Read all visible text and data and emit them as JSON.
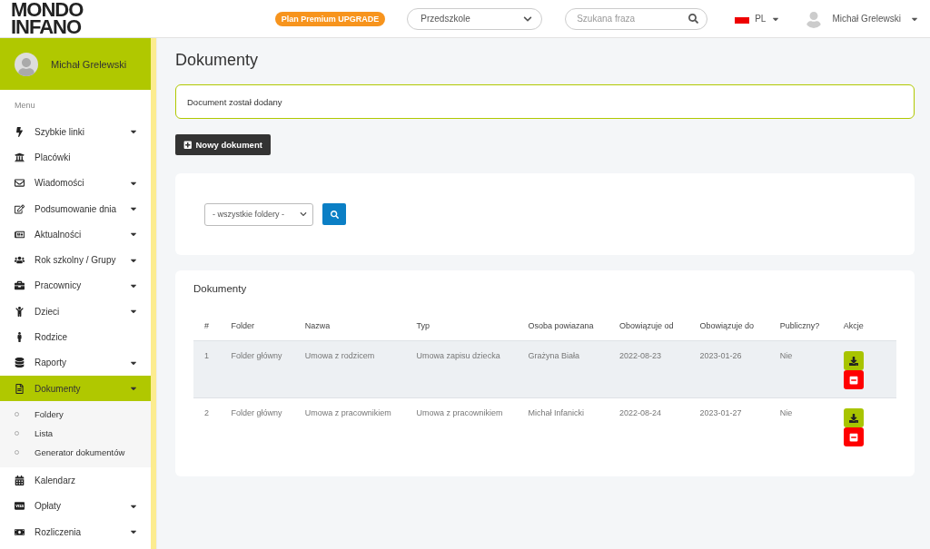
{
  "header": {
    "logo_top": "MONDO",
    "logo_bottom": "INFANO",
    "premium_badge": "Plan Premium UPGRADE",
    "facility_select": "Przedszkole",
    "search": {
      "placeholder": "Szukana fraza"
    },
    "language": "PL",
    "user": "Michał Grelewski"
  },
  "sidebar": {
    "user": "Michał Grelewski",
    "menu_label": "Menu",
    "items": [
      {
        "label": "Szybkie linki",
        "has_submenu": true,
        "selected": false
      },
      {
        "label": "Placówki",
        "has_submenu": false,
        "selected": false
      },
      {
        "label": "Wiadomości",
        "has_submenu": true,
        "selected": false
      },
      {
        "label": "Podsumowanie dnia",
        "has_submenu": true,
        "selected": false
      },
      {
        "label": "Aktualności",
        "has_submenu": true,
        "selected": false
      },
      {
        "label": "Rok szkolny / Grupy",
        "has_submenu": true,
        "selected": false
      },
      {
        "label": "Pracownicy",
        "has_submenu": true,
        "selected": false
      },
      {
        "label": "Dzieci",
        "has_submenu": true,
        "selected": false
      },
      {
        "label": "Rodzice",
        "has_submenu": false,
        "selected": false
      },
      {
        "label": "Raporty",
        "has_submenu": true,
        "selected": false
      },
      {
        "label": "Dokumenty",
        "has_submenu": true,
        "selected": true,
        "children": [
          {
            "label": "Foldery"
          },
          {
            "label": "Lista"
          },
          {
            "label": "Generator dokumentów"
          }
        ]
      },
      {
        "label": "Kalendarz",
        "has_submenu": false,
        "selected": false
      },
      {
        "label": "Opłaty",
        "has_submenu": true,
        "selected": false
      },
      {
        "label": "Rozliczenia",
        "has_submenu": true,
        "selected": false
      }
    ]
  },
  "page_title": "Dokumenty",
  "alert": "Document został dodany",
  "new_button": "Nowy dokument",
  "filter": {
    "folder_select": "- wszystkie foldery -"
  },
  "table": {
    "title": "Dokumenty",
    "columns": [
      "#",
      "Folder",
      "Nazwa",
      "Typ",
      "Osoba powiazana",
      "Obowiązuje od",
      "Obowiązuje do",
      "Publiczny?",
      "Akcje"
    ],
    "rows": [
      {
        "selected": true,
        "cells": [
          "1",
          "Folder główny",
          "Umowa z rodzicem",
          "Umowa zapisu dziecka",
          "Grażyna Biała",
          "2022-08-23",
          "2023-01-26",
          "Nie"
        ]
      },
      {
        "selected": false,
        "cells": [
          "2",
          "Folder główny",
          "Umowa z pracownikiem",
          "Umowa z pracownikiem",
          "Michał Infanicki",
          "2022-08-24",
          "2023-01-27",
          "Nie"
        ]
      }
    ]
  }
}
